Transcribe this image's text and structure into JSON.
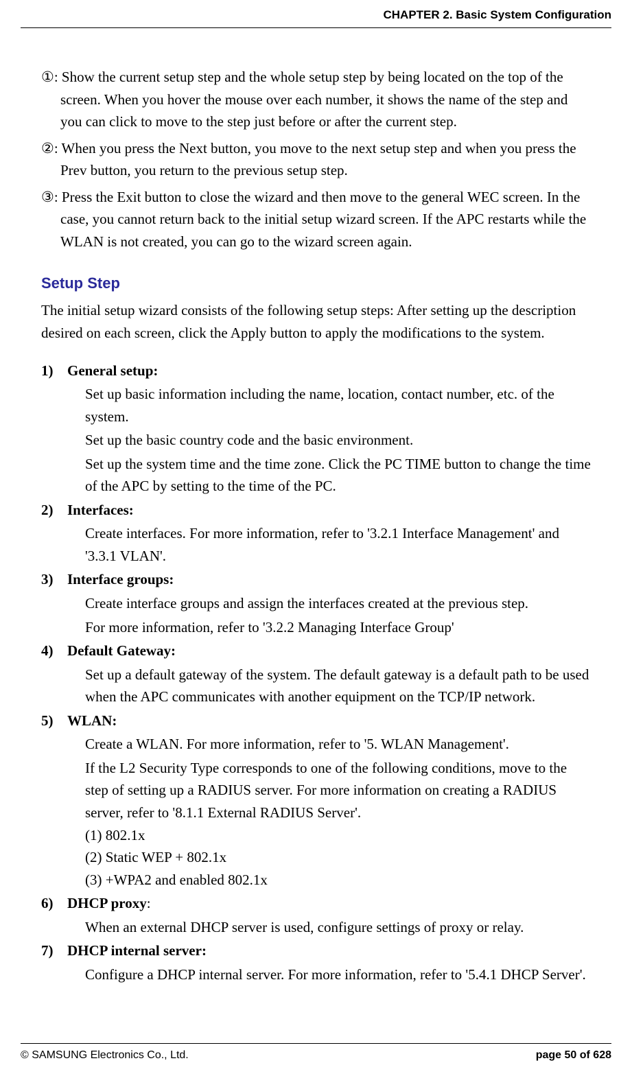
{
  "header": {
    "chapter": "CHAPTER 2. Basic System Configuration"
  },
  "circled": [
    {
      "marker": "①",
      "text": "Show the current setup step and the whole setup step by being located on the top of the screen. When you hover the mouse over each number, it shows the name of the step and you can click to move to the step just before or after the current step."
    },
    {
      "marker": "②",
      "text": "When you press the Next button, you move to the next setup step and when you press the Prev button, you return to the previous setup step."
    },
    {
      "marker": "③",
      "text": "Press the Exit button to close the wizard and then move to the general WEC screen. In the case, you cannot return back to the initial setup wizard screen. If the APC restarts while the WLAN is not created, you can go to the wizard screen again."
    }
  ],
  "section": {
    "title": "Setup Step",
    "intro": "The initial setup wizard consists of the following setup steps: After setting up the description desired on each screen, click the Apply button to apply the modifications to the system."
  },
  "steps": [
    {
      "num": "1)",
      "label": "General setup:",
      "bullets": [
        "Set up basic information including the name, location, contact number, etc. of the system.",
        "Set up the basic country code and the basic environment.",
        "Set up the system time and the time zone. Click the PC TIME button to change the time of the APC by setting to the time of the PC."
      ]
    },
    {
      "num": "2)",
      "label": "Interfaces:",
      "bullets": [
        "Create interfaces. For more information, refer to '3.2.1 Interface Management' and '3.3.1 VLAN'."
      ]
    },
    {
      "num": "3)",
      "label": "Interface groups:",
      "bullets": [
        "Create interface groups and assign the interfaces created at the previous step.",
        "For more information, refer to '3.2.2 Managing Interface Group'"
      ]
    },
    {
      "num": "4)",
      "label": "Default Gateway:",
      "bullets": [
        "Set up a default gateway of the system. The default gateway is a default path to be used when the APC communicates with another equipment on the TCP/IP network."
      ]
    },
    {
      "num": "5)",
      "label": "WLAN:",
      "bullets": [
        "Create a WLAN. For more information, refer to '5. WLAN Management'.",
        "If the L2 Security Type corresponds to one of the following conditions, move to the step of setting up a RADIUS server. For more information on creating a RADIUS server, refer to '8.1.1 External RADIUS Server'.\n(1) 802.1x\n(2) Static WEP + 802.1x\n(3) +WPA2 and enabled 802.1x"
      ]
    },
    {
      "num": "6)",
      "label": "DHCP proxy",
      "label_suffix": ":",
      "bullets": [
        "When an external DHCP server is used, configure settings of proxy or relay."
      ]
    },
    {
      "num": "7)",
      "label": "DHCP internal server:",
      "bullets": [
        "Configure a DHCP internal server. For more information, refer to '5.4.1 DHCP Server'."
      ]
    }
  ],
  "footer": {
    "copyright": "© SAMSUNG Electronics Co., Ltd.",
    "page": "page 50 of 628"
  }
}
